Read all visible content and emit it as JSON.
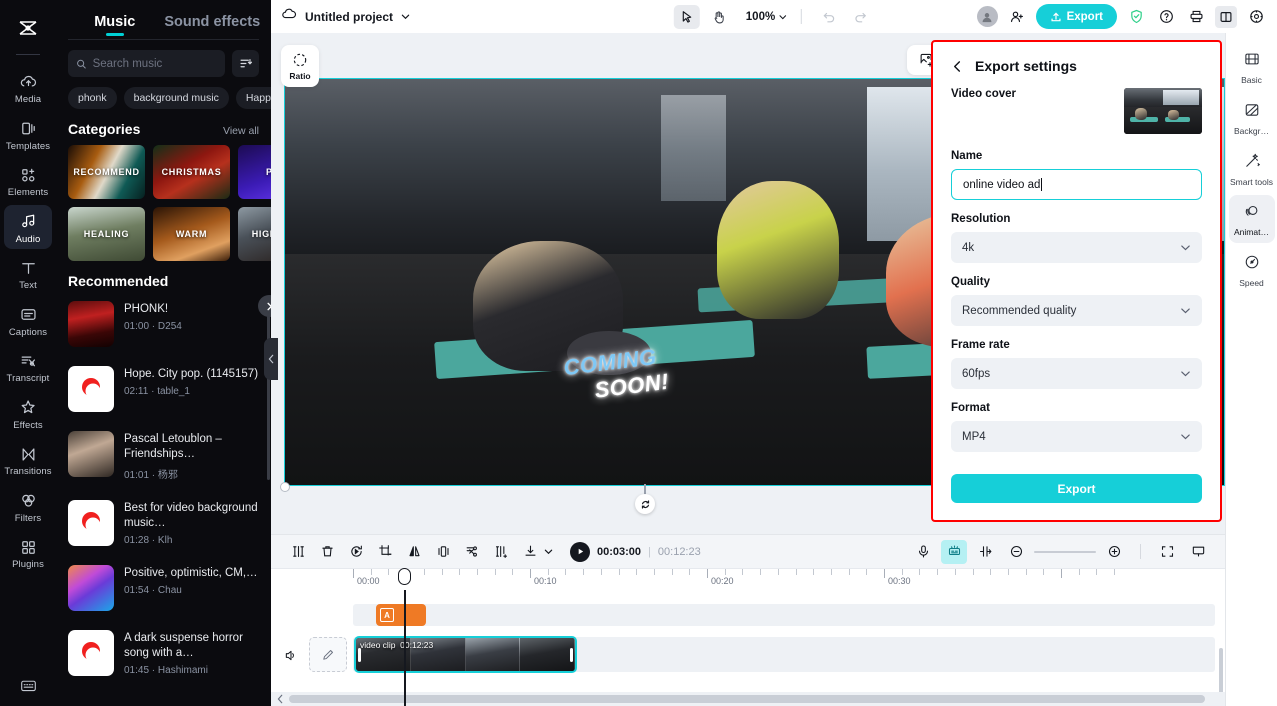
{
  "rail": {
    "logo": "capcut-logo",
    "items": [
      {
        "label": "Media",
        "icon": "cloud-upload-icon",
        "active": false
      },
      {
        "label": "Templates",
        "icon": "templates-icon",
        "active": false
      },
      {
        "label": "Elements",
        "icon": "elements-icon",
        "active": false
      },
      {
        "label": "Audio",
        "icon": "audio-note-icon",
        "active": true
      },
      {
        "label": "Text",
        "icon": "text-icon",
        "active": false
      },
      {
        "label": "Captions",
        "icon": "captions-icon",
        "active": false
      },
      {
        "label": "Transcript",
        "icon": "transcript-icon",
        "active": false
      },
      {
        "label": "Effects",
        "icon": "effects-star-icon",
        "active": false
      },
      {
        "label": "Transitions",
        "icon": "transitions-icon",
        "active": false
      },
      {
        "label": "Filters",
        "icon": "filters-icon",
        "active": false
      },
      {
        "label": "Plugins",
        "icon": "plugins-grid-icon",
        "active": false
      }
    ],
    "bottom_icon": "keyboard-shortcuts-icon"
  },
  "music_panel": {
    "tabs": [
      {
        "label": "Music",
        "active": true
      },
      {
        "label": "Sound effects",
        "active": false
      }
    ],
    "search": {
      "placeholder": "Search music",
      "value": "",
      "icon": "search-icon"
    },
    "filter_icon": "filter-icon",
    "chips": [
      "phonk",
      "background music",
      "Happy"
    ],
    "categories_title": "Categories",
    "view_all": "View all",
    "categories": [
      {
        "label": "RECOMMEND"
      },
      {
        "label": "CHRISTMAS"
      },
      {
        "label": "POP"
      },
      {
        "label": "HEALING"
      },
      {
        "label": "WARM"
      },
      {
        "label": "HIGH TEM"
      }
    ],
    "recommended_title": "Recommended",
    "tracks": [
      {
        "name": "PHONK!",
        "duration": "01:00",
        "artist": "D254",
        "thumb": "phonk-car"
      },
      {
        "name": "Hope. City pop. (1145157)",
        "duration": "02:11",
        "artist": "table_1",
        "thumb": "capcut-logo"
      },
      {
        "name": "Pascal Letoublon – Friendships…",
        "duration": "01:01",
        "artist": "杨邪",
        "thumb": "girl-photo"
      },
      {
        "name": "Best for video background music…",
        "duration": "01:28",
        "artist": "Klh",
        "thumb": "capcut-logo"
      },
      {
        "name": "Positive, optimistic, CM,…",
        "duration": "01:54",
        "artist": "Chau",
        "thumb": "gradient-wave"
      },
      {
        "name": "A dark suspense horror song with a…",
        "duration": "01:45",
        "artist": "Hashimami",
        "thumb": "capcut-logo"
      }
    ]
  },
  "topbar": {
    "cloud_icon": "cloud-icon",
    "project_name": "Untitled project",
    "project_chevron": "chevron-down-icon",
    "select_tool_icon": "cursor-arrow-icon",
    "hand_tool_icon": "hand-icon",
    "zoom_level": "100%",
    "undo_icon": "undo-icon",
    "redo_icon": "redo-icon",
    "avatar_icon": "user-avatar-icon",
    "add_member_icon": "add-person-icon",
    "export_label": "Export",
    "export_icon": "upload-icon",
    "shield_icon": "shield-check-icon",
    "help_icon": "question-circle-icon",
    "print_icon": "printer-icon",
    "layout_icon": "layout-panel-icon",
    "settings_icon": "settings-gear-icon"
  },
  "preview": {
    "ratio_label": "Ratio",
    "ratio_icon": "ratio-circle-icon",
    "tools": [
      {
        "icon": "image-add-icon"
      },
      {
        "icon": "auto-fit-icon"
      },
      {
        "icon": "crop-icon"
      },
      {
        "icon": "replace-media-icon"
      }
    ],
    "tools_chevron": "chevron-down-icon",
    "more_icon": "more-dots-icon",
    "overlay_text_line1": "COMING",
    "overlay_text_line2": "SOON!",
    "rotate_icon": "rotate-handle-icon"
  },
  "property_rail": {
    "items": [
      {
        "label": "Basic",
        "icon": "basic-film-icon",
        "active": false
      },
      {
        "label": "Backgr…",
        "icon": "background-icon",
        "active": false
      },
      {
        "label": "Smart tools",
        "icon": "magic-wand-icon",
        "active": false
      },
      {
        "label": "Animat…",
        "icon": "animation-icon",
        "active": true
      },
      {
        "label": "Speed",
        "icon": "speedometer-icon",
        "active": false
      }
    ]
  },
  "timeline": {
    "tools": [
      {
        "icon": "split-icon",
        "highlight": false
      },
      {
        "icon": "delete-trash-icon",
        "highlight": false
      },
      {
        "icon": "reverse-icon",
        "highlight": false
      },
      {
        "icon": "crop-clip-icon",
        "highlight": false
      },
      {
        "icon": "mirror-icon",
        "highlight": false
      },
      {
        "icon": "freeze-frame-icon",
        "highlight": false
      },
      {
        "icon": "cut-scissors-icon",
        "highlight": false
      },
      {
        "icon": "split-add-icon",
        "highlight": false
      },
      {
        "icon": "download-icon",
        "highlight": false
      }
    ],
    "download_chevron": "chevron-down-icon",
    "play_icon": "play-icon",
    "current_time": "00:03:00",
    "separator": "|",
    "total_time": "00:12:23",
    "right_tools": [
      {
        "icon": "microphone-icon",
        "highlight": false
      },
      {
        "icon": "auto-captions-icon",
        "highlight": true
      },
      {
        "icon": "keyframe-icon",
        "highlight": false
      }
    ],
    "zoom_out_icon": "zoom-out-icon",
    "zoom_in_icon": "zoom-in-icon",
    "clock_icon": "timer-icon",
    "fullscreen_icon": "fullscreen-icon",
    "present_icon": "present-icon",
    "ruler_labels": [
      "00:00",
      "00:10",
      "00:20",
      "00:30"
    ],
    "text_clip": {
      "icon_letter": "A"
    },
    "video_clip": {
      "name": "video clip",
      "duration": "00:12:23"
    },
    "speaker_icon": "speaker-icon",
    "edit_pencil_icon": "pencil-edit-icon",
    "scroll_left_icon": "chevron-left-icon"
  },
  "export_settings": {
    "back_icon": "chevron-left-icon",
    "title": "Export settings",
    "cover_label": "Video cover",
    "name_label": "Name",
    "name_value": "online video ad",
    "fields": [
      {
        "label": "Resolution",
        "value": "4k"
      },
      {
        "label": "Quality",
        "value": "Recommended quality"
      },
      {
        "label": "Frame rate",
        "value": "60fps"
      },
      {
        "label": "Format",
        "value": "MP4"
      }
    ],
    "chevron_icon": "chevron-down-icon",
    "export_button": "Export",
    "highlight_color": "#ff0000",
    "accent_color": "#16cfd8"
  }
}
